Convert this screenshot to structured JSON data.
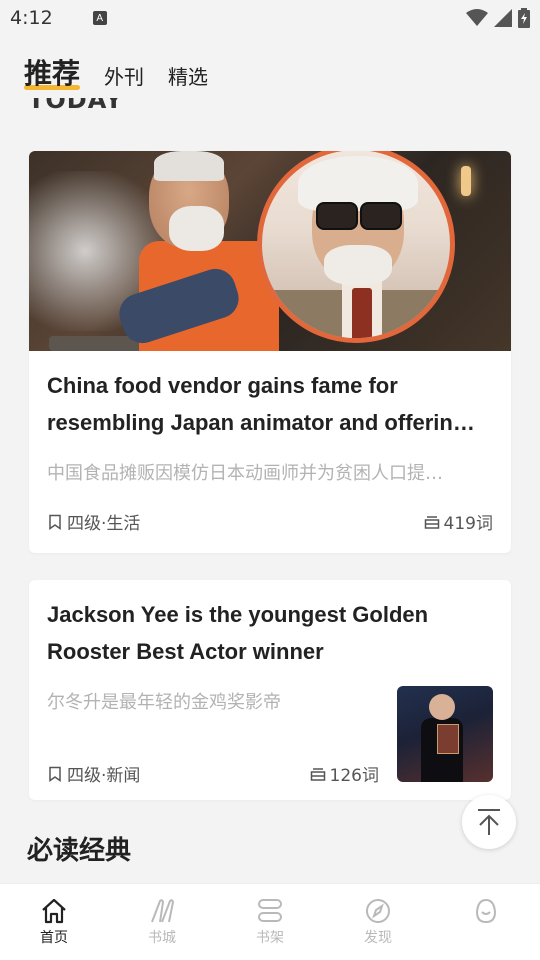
{
  "status_bar": {
    "time": "4:12",
    "notification_glyph": "A"
  },
  "top_tabs": [
    {
      "label": "推荐",
      "active": true
    },
    {
      "label": "外刊",
      "active": false
    },
    {
      "label": "精选",
      "active": false
    }
  ],
  "section_today": "TODAY",
  "articles": [
    {
      "title": "China food vendor gains fame for resembling Japan animator and offerin…",
      "subtitle": "中国食品摊贩因模仿日本动画师并为贫困人口提…",
      "level": "四级·生活",
      "words": "419词"
    },
    {
      "title": "Jackson Yee is the youngest Golden Rooster Best Actor winner",
      "subtitle": "尔冬升是最年轻的金鸡奖影帝",
      "level": "四级·新闻",
      "words": "126词"
    }
  ],
  "section_classics": "必读经典",
  "bottom_nav": [
    {
      "label": "首页",
      "icon": "home-icon",
      "active": true
    },
    {
      "label": "书城",
      "icon": "bookstore-icon",
      "active": false
    },
    {
      "label": "书架",
      "icon": "bookshelf-icon",
      "active": false
    },
    {
      "label": "发现",
      "icon": "compass-icon",
      "active": false
    },
    {
      "label": "",
      "icon": "egg-icon",
      "active": false
    }
  ],
  "colors": {
    "accent": "#f5b731",
    "background": "#f3f3f4",
    "muted_text": "#b3b3b3"
  }
}
